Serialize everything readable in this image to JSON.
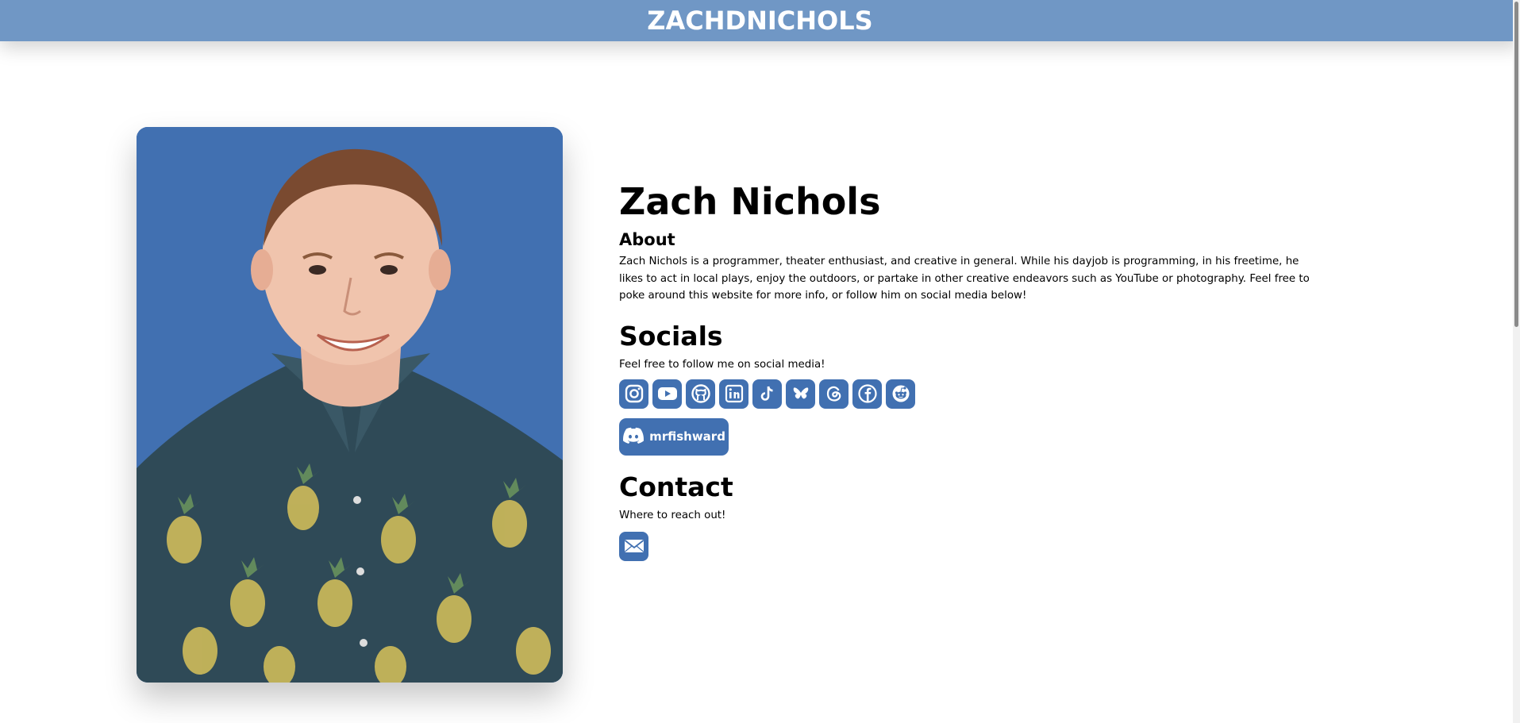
{
  "header": {
    "site_title": "ZACHDNICHOLS",
    "background": "#7097c5"
  },
  "profile": {
    "name": "Zach Nichols",
    "about_heading": "About",
    "about_text": "Zach Nichols is a programmer, theater enthusiast, and creative in general. While his dayjob is programming, in his freetime, he likes to act in local plays, enjoy the outdoors, or partake in other creative endeavors such as YouTube or photography. Feel free to poke around this website for more info, or follow him on social media below!"
  },
  "socials": {
    "heading": "Socials",
    "subtitle": "Feel free to follow me on social media!",
    "icons": [
      "instagram-icon",
      "youtube-icon",
      "github-icon",
      "linkedin-icon",
      "tiktok-icon",
      "bluesky-icon",
      "threads-icon",
      "facebook-icon",
      "reddit-icon"
    ],
    "discord_handle": "mrfishward"
  },
  "contact": {
    "heading": "Contact",
    "subtitle": "Where to reach out!",
    "icon": "mail-icon"
  },
  "colors": {
    "accent": "#4170b1",
    "header": "#7097c5"
  }
}
